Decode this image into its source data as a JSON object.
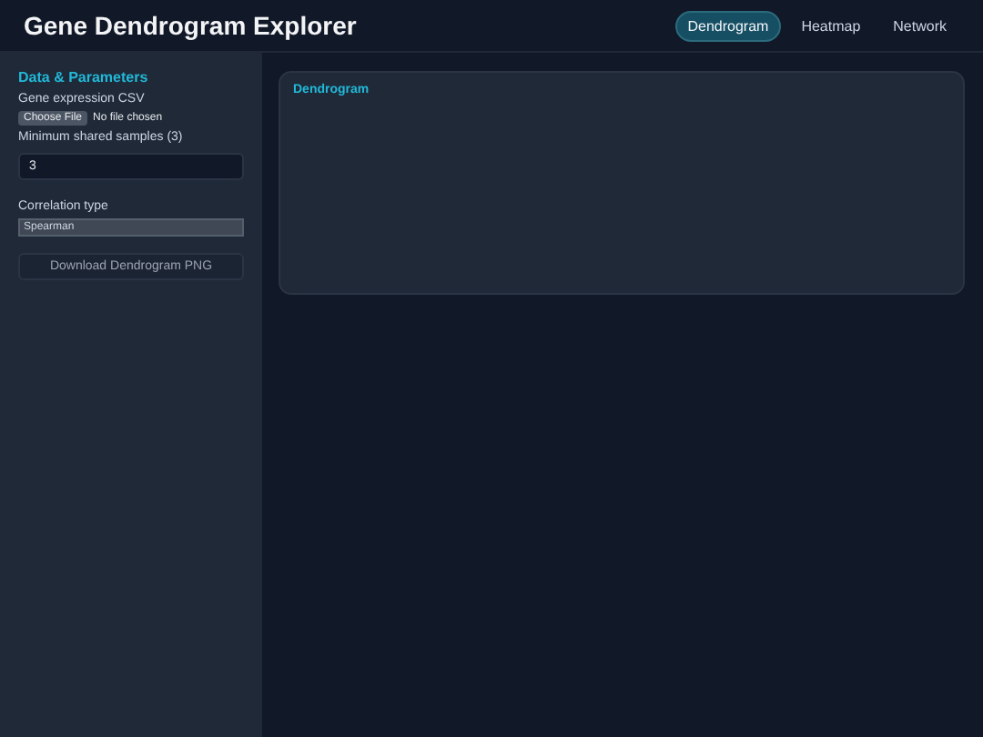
{
  "header": {
    "title": "Gene Dendrogram Explorer",
    "tabs": [
      {
        "label": "Dendrogram",
        "selected": true
      },
      {
        "label": "Heatmap",
        "selected": false
      },
      {
        "label": "Network",
        "selected": false
      }
    ]
  },
  "sidebar": {
    "heading": "Data & Parameters",
    "file_label": "Gene expression CSV",
    "file_button": "Choose File",
    "file_status": "No file chosen",
    "min_label": "Minimum shared samples (3)",
    "min_value": "3",
    "corr_label": "Correlation type",
    "corr_value": "Spearman",
    "download_button": "Download Dendrogram PNG"
  },
  "card": {
    "title": "Dendrogram"
  }
}
